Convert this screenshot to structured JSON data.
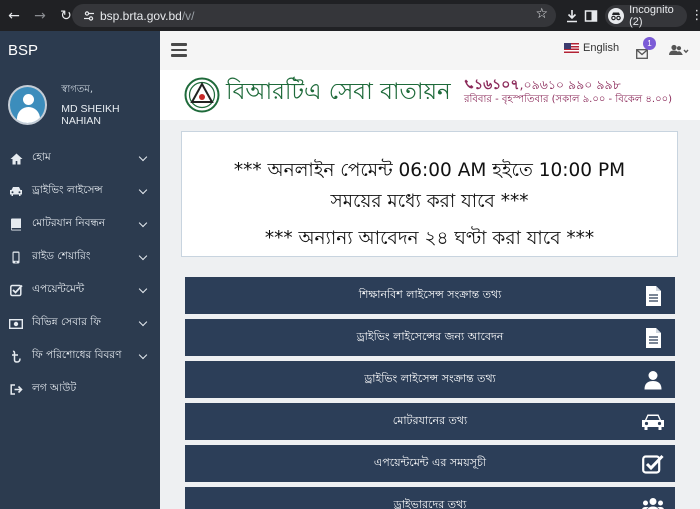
{
  "browser": {
    "url_host": "bsp.brta.gov.bd",
    "url_path": "/v/",
    "profile_label": "Incognito (2)"
  },
  "sidebar": {
    "brand": "BSP",
    "user": {
      "welcome": "স্বাগতম,",
      "name": "MD SHEIKH NAHIAN"
    },
    "items": [
      {
        "label": "হোম",
        "icon": "home-icon",
        "has_submenu": true
      },
      {
        "label": "ড্রাইভিং লাইসেন্স",
        "icon": "car-icon",
        "has_submenu": true
      },
      {
        "label": "মোটরযান নিবন্ধন",
        "icon": "book-icon",
        "has_submenu": true
      },
      {
        "label": "রাইড শেয়ারিং",
        "icon": "mobile-icon",
        "has_submenu": true
      },
      {
        "label": "এপয়েন্টমেন্ট",
        "icon": "checkbox-icon",
        "has_submenu": true
      },
      {
        "label": "বিভিন্ন সেবার ফি",
        "icon": "money-icon",
        "has_submenu": true
      },
      {
        "label": "ফি পরিশোধের বিবরণ",
        "icon": "taka-icon",
        "has_submenu": true
      },
      {
        "label": "লগ আউট",
        "icon": "sign-out-icon",
        "has_submenu": false
      }
    ]
  },
  "topbar": {
    "language": "English",
    "message_count": "1"
  },
  "header": {
    "title": "বিআরটিএ সেবা বাতায়ন",
    "hotline_short": "১৬১০৭",
    "hotline_rest": ",০৯৬১০ ৯৯০ ৯৯৮",
    "hours": "রবিবার - বৃহস্পতিবার (সকাল ৯.০০ - বিকেল ৪.০০)"
  },
  "notice": {
    "line1": "*** অনলাইন পেমেন্ট 06:00 AM হইতে 10:00 PM",
    "line2": "সময়ের মধ্যে করা যাবে ***",
    "line3": "*** অন্যান্য আবেদন ২৪ ঘণ্টা করা যাবে ***"
  },
  "services": [
    {
      "label": "শিক্ষানবিশ লাইসেন্স সংক্রান্ত তথ্য",
      "icon": "document-icon"
    },
    {
      "label": "ড্রাইভিং লাইসেন্সের জন্য আবেদন",
      "icon": "document-icon"
    },
    {
      "label": "ড্রাইভিং লাইসেন্স সংক্রান্ত তথ্য",
      "icon": "user-icon"
    },
    {
      "label": "মোটরযানের তথ্য",
      "icon": "car-icon"
    },
    {
      "label": "এপয়েন্টমেন্ট এর সময়সূচী",
      "icon": "checkbox-icon"
    },
    {
      "label": "ড্রাইভারদের তথ্য",
      "icon": "group-icon"
    }
  ]
}
